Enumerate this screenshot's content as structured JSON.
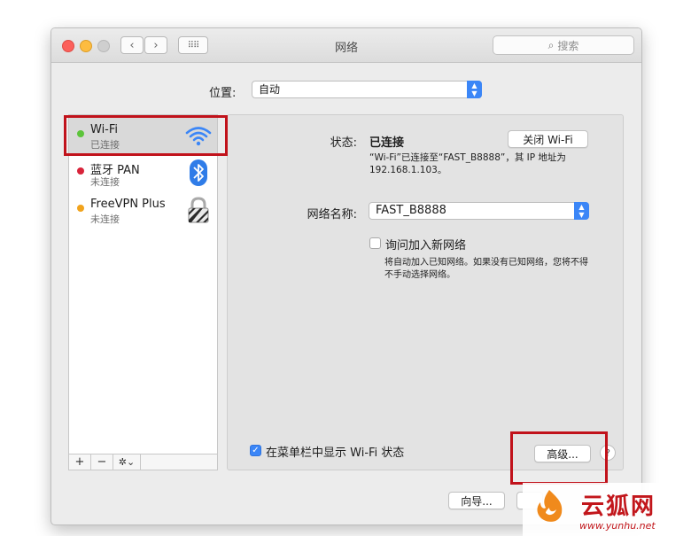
{
  "window": {
    "title": "网络",
    "search_placeholder": "搜索",
    "back_glyph": "‹",
    "forward_glyph": "›",
    "grid_glyph": "⠿⠿"
  },
  "location": {
    "label": "位置:",
    "value": "自动"
  },
  "services": [
    {
      "name": "Wi-Fi",
      "status": "已连接",
      "dot_color": "#5cc43a",
      "icon": "wifi-icon"
    },
    {
      "name": "蓝牙 PAN",
      "status": "未连接",
      "dot_color": "#d8233a",
      "icon": "bluetooth-icon"
    },
    {
      "name": "FreeVPN Plus",
      "status": "未连接",
      "dot_color": "#f1a31c",
      "icon": "vpn-lock-icon"
    }
  ],
  "sidebar_tools": {
    "add": "+",
    "remove": "−",
    "gear": "✲⌄"
  },
  "detail": {
    "status_label": "状态:",
    "status_value": "已连接",
    "wifi_off_button": "关闭 Wi-Fi",
    "status_desc": "“Wi-Fi”已连接至“FAST_B8888”，其 IP 地址为 192.168.1.103。",
    "network_name_label": "网络名称:",
    "network_name_value": "FAST_B8888",
    "ask_join_label": "询问加入新网络",
    "ask_join_checked": false,
    "ask_join_desc": "将自动加入已知网络。如果没有已知网络，您将不得不手动选择网络。",
    "show_in_menubar_label": "在菜单栏中显示 Wi-Fi 状态",
    "show_in_menubar_checked": true,
    "advanced_button": "高级...",
    "help_glyph": "?"
  },
  "footer": {
    "assistant_button": "向导..."
  },
  "watermark": {
    "text": "云狐网",
    "url": "www.yunhu.net"
  },
  "colors": {
    "accent": "#3b86f7",
    "highlight_box": "#c1121b"
  }
}
